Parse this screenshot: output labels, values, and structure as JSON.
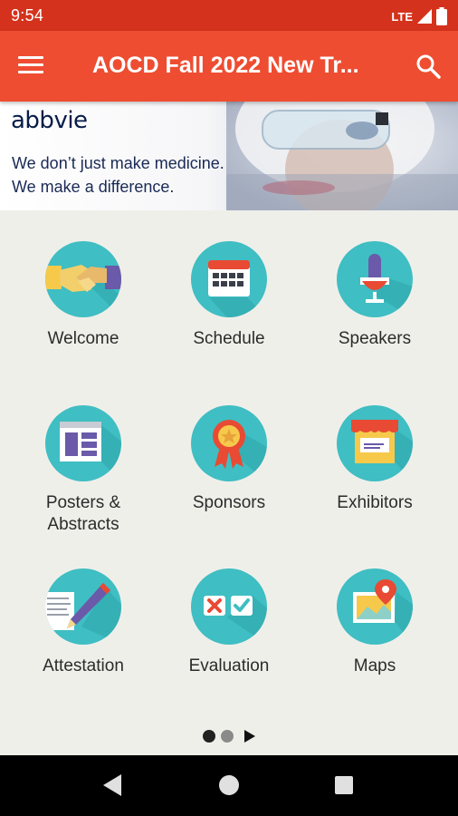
{
  "status_bar": {
    "time": "9:54",
    "network": "LTE"
  },
  "app_bar": {
    "title": "AOCD Fall 2022 New Tr...",
    "menu_icon": "hamburger-menu-icon",
    "search_icon": "search-icon"
  },
  "banner": {
    "logo": "abbvie",
    "line1": "We don’t just make medicine.",
    "line2": "We make a difference."
  },
  "tiles": [
    {
      "label": "Welcome",
      "icon": "handshake-icon"
    },
    {
      "label": "Schedule",
      "icon": "calendar-icon"
    },
    {
      "label": "Speakers",
      "icon": "microphone-icon"
    },
    {
      "label": "Posters &\nAbstracts",
      "icon": "poster-icon"
    },
    {
      "label": "Sponsors",
      "icon": "ribbon-award-icon"
    },
    {
      "label": "Exhibitors",
      "icon": "booth-icon"
    },
    {
      "label": "Attestation",
      "icon": "pencil-document-icon"
    },
    {
      "label": "Evaluation",
      "icon": "checkbox-icon"
    },
    {
      "label": "Maps",
      "icon": "map-pin-icon"
    }
  ],
  "pager": {
    "current": 1,
    "total": 2
  },
  "colors": {
    "app_bar": "#ee4d31",
    "status_bar": "#d4321c",
    "icon_circle": "#3fbec3",
    "background": "#efefea"
  }
}
